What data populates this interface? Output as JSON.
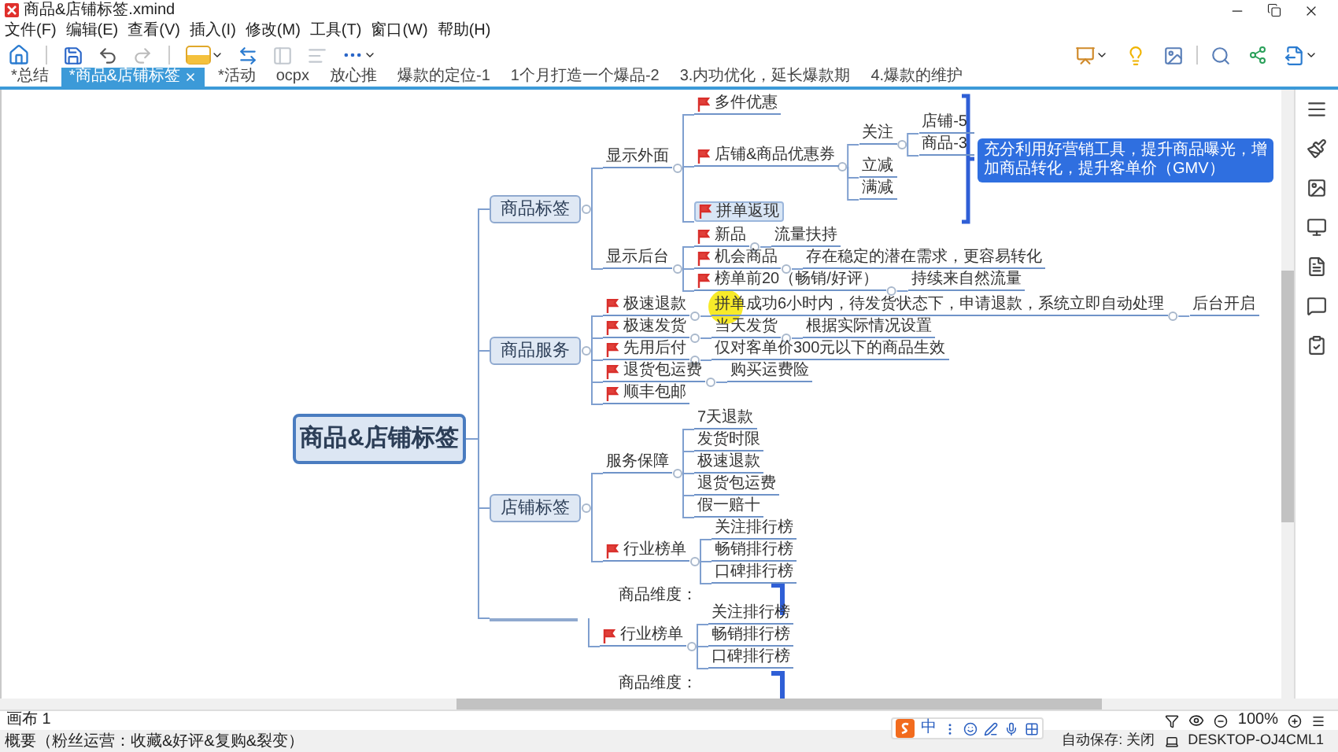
{
  "window": {
    "title": "商品&店铺标签.xmind"
  },
  "menu": [
    "文件(F)",
    "编辑(E)",
    "查看(V)",
    "插入(I)",
    "修改(M)",
    "工具(T)",
    "窗口(W)",
    "帮助(H)"
  ],
  "tabs": [
    {
      "label": "*总结",
      "selected": false
    },
    {
      "label": "*商品&店铺标签",
      "selected": true
    },
    {
      "label": "*活动",
      "selected": false
    },
    {
      "label": "ocpx",
      "selected": false
    },
    {
      "label": "放心推",
      "selected": false
    },
    {
      "label": "爆款的定位-1",
      "selected": false
    },
    {
      "label": "1个月打造一个爆品-2",
      "selected": false
    },
    {
      "label": "3.内功优化，延长爆款期",
      "selected": false
    },
    {
      "label": "4.爆款的维护",
      "selected": false
    }
  ],
  "mindmap": {
    "root": {
      "text": "商品&店铺标签",
      "children": [
        {
          "kind": "topic",
          "text": "商品标签",
          "selected": false,
          "children": [
            {
              "text": "显示外面",
              "flag": false,
              "selected": false,
              "children": [
                {
                  "text": "多件优惠",
                  "flag": true,
                  "selected": false
                },
                {
                  "text": "店铺&商品优惠券",
                  "flag": true,
                  "selected": false,
                  "children": [
                    {
                      "text": "关注",
                      "flag": false,
                      "selected": false,
                      "children": [
                        {
                          "text": "店铺-5",
                          "flag": false,
                          "selected": false
                        },
                        {
                          "text": "商品-3",
                          "flag": false,
                          "selected": false
                        }
                      ]
                    },
                    {
                      "text": "立减",
                      "flag": false,
                      "selected": false
                    },
                    {
                      "text": "满减",
                      "flag": false,
                      "selected": false
                    }
                  ]
                },
                {
                  "text": "拼单返现",
                  "flag": true,
                  "selected": true
                }
              ]
            },
            {
              "text": "显示后台",
              "flag": false,
              "selected": false,
              "children": [
                {
                  "text": "新品",
                  "flag": true,
                  "selected": false,
                  "children": [
                    {
                      "text": "流量扶持",
                      "flag": false,
                      "selected": false
                    }
                  ]
                },
                {
                  "text": "机会商品",
                  "flag": true,
                  "selected": false,
                  "children": [
                    {
                      "text": "存在稳定的潜在需求，更容易转化",
                      "flag": false,
                      "selected": false
                    }
                  ]
                },
                {
                  "text": "榜单前20（畅销/好评）",
                  "flag": true,
                  "selected": false,
                  "children": [
                    {
                      "text": "持续来自然流量",
                      "flag": false,
                      "selected": false
                    }
                  ]
                }
              ]
            }
          ]
        },
        {
          "kind": "topic",
          "text": "商品服务",
          "selected": false,
          "children": [
            {
              "text": "极速退款",
              "flag": true,
              "selected": false,
              "children": [
                {
                  "text": "拼单成功6小时内，待发货状态下，申请退款，系统立即自动处理",
                  "flag": false,
                  "selected": false,
                  "children": [
                    {
                      "text": "后台开启",
                      "flag": false,
                      "selected": false
                    }
                  ]
                }
              ]
            },
            {
              "text": "极速发货",
              "flag": true,
              "selected": false,
              "children": [
                {
                  "text": "当天发货",
                  "flag": false,
                  "selected": false,
                  "children": [
                    {
                      "text": "根据实际情况设置",
                      "flag": false,
                      "selected": false
                    }
                  ]
                }
              ]
            },
            {
              "text": "先用后付",
              "flag": true,
              "selected": false,
              "children": [
                {
                  "text": "仅对客单价300元以下的商品生效",
                  "flag": false,
                  "selected": false
                }
              ]
            },
            {
              "text": "退货包运费",
              "flag": true,
              "selected": false,
              "children": [
                {
                  "text": "购买运费险",
                  "flag": false,
                  "selected": false
                }
              ]
            },
            {
              "text": "顺丰包邮",
              "flag": true,
              "selected": false
            }
          ]
        },
        {
          "kind": "topic",
          "text": "店铺标签",
          "selected": false,
          "children": [
            {
              "text": "服务保障",
              "flag": false,
              "selected": false,
              "children": [
                {
                  "text": "7天退款",
                  "flag": false,
                  "selected": false
                },
                {
                  "text": "发货时限",
                  "flag": false,
                  "selected": false
                },
                {
                  "text": "极速退款",
                  "flag": false,
                  "selected": false
                },
                {
                  "text": "退货包运费",
                  "flag": false,
                  "selected": false
                },
                {
                  "text": "假一赔十",
                  "flag": false,
                  "selected": false
                }
              ]
            },
            {
              "text": "行业榜单",
              "flag": true,
              "selected": false,
              "children": [
                {
                  "text": "关注排行榜",
                  "flag": false,
                  "selected": false
                },
                {
                  "text": "畅销排行榜",
                  "flag": false,
                  "selected": false
                },
                {
                  "text": "口碑排行榜",
                  "flag": false,
                  "selected": false
                }
              ]
            }
          ]
        },
        {
          "kind": "covered",
          "children": [
            {
              "text": "行业榜单",
              "flag": true,
              "selected": false,
              "children": [
                {
                  "text": "关注排行榜",
                  "flag": false,
                  "selected": false
                },
                {
                  "text": "畅销排行榜",
                  "flag": false,
                  "selected": false
                },
                {
                  "text": "口碑排行榜",
                  "flag": false,
                  "selected": false
                }
              ]
            }
          ]
        }
      ]
    },
    "summary": "充分利用好营销工具，提升商品曝光，增加商品转化，提升客单价（GMV）",
    "notes": [
      "商品维度：",
      "商品维度："
    ]
  },
  "sheet": {
    "name": "画布 1",
    "zoom": "100%"
  },
  "ime": {
    "mode": "中"
  },
  "status_bar": {
    "left": "概要（粉丝运营：收藏&好评&复购&裂变）",
    "autosave": "自动保存: 关闭",
    "computer": "DESKTOP-OJ4CML1"
  }
}
